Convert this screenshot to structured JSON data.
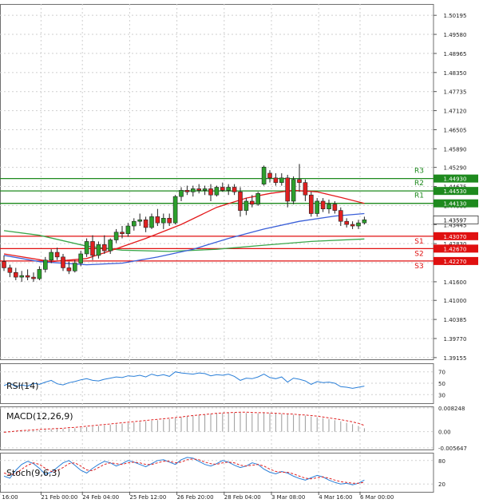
{
  "chart_data": {
    "type": "candlestick",
    "main": {
      "ylim": [
        1.391,
        1.5056
      ],
      "price_ticks": [
        "1.50195",
        "1.49580",
        "1.48965",
        "1.48350",
        "1.47735",
        "1.47120",
        "1.46505",
        "1.45890",
        "1.45290",
        "1.44675",
        "1.44060",
        "1.43445",
        "1.42830",
        "1.42215",
        "1.41600",
        "1.41000",
        "1.40385",
        "1.39770",
        "1.39155"
      ],
      "current_price": "1.43597",
      "levels": [
        {
          "name": "R3",
          "value": 1.4493,
          "label": "1.44930",
          "color": "#1e8a1e"
        },
        {
          "name": "R2",
          "value": 1.4453,
          "label": "1.44530",
          "color": "#1e8a1e"
        },
        {
          "name": "R1",
          "value": 1.4413,
          "label": "1.44130",
          "color": "#1e8a1e"
        },
        {
          "name": "S1",
          "value": 1.4307,
          "label": "1.43070",
          "color": "#e01010"
        },
        {
          "name": "S2",
          "value": 1.4267,
          "label": "1.42670",
          "color": "#e01010"
        },
        {
          "name": "S3",
          "value": 1.4227,
          "label": "1.42270",
          "color": "#e01010"
        }
      ],
      "candles": [
        [
          1.4225,
          1.4245,
          1.4195,
          1.4205
        ],
        [
          1.4205,
          1.4215,
          1.4175,
          1.419
        ],
        [
          1.419,
          1.4205,
          1.4165,
          1.4175
        ],
        [
          1.4175,
          1.4195,
          1.416,
          1.418
        ],
        [
          1.418,
          1.42,
          1.4165,
          1.4175
        ],
        [
          1.4175,
          1.419,
          1.416,
          1.417
        ],
        [
          1.417,
          1.421,
          1.4165,
          1.42
        ],
        [
          1.42,
          1.424,
          1.419,
          1.423
        ],
        [
          1.423,
          1.4265,
          1.422,
          1.4255
        ],
        [
          1.4255,
          1.427,
          1.423,
          1.424
        ],
        [
          1.424,
          1.425,
          1.4195,
          1.4205
        ],
        [
          1.4205,
          1.4225,
          1.4185,
          1.4195
        ],
        [
          1.4195,
          1.423,
          1.419,
          1.422
        ],
        [
          1.422,
          1.426,
          1.421,
          1.425
        ],
        [
          1.425,
          1.43,
          1.424,
          1.429
        ],
        [
          1.429,
          1.431,
          1.423,
          1.4245
        ],
        [
          1.4245,
          1.429,
          1.4235,
          1.428
        ],
        [
          1.428,
          1.431,
          1.425,
          1.426
        ],
        [
          1.426,
          1.43,
          1.425,
          1.4295
        ],
        [
          1.4295,
          1.433,
          1.4285,
          1.432
        ],
        [
          1.432,
          1.434,
          1.43,
          1.4315
        ],
        [
          1.4315,
          1.435,
          1.4305,
          1.434
        ],
        [
          1.434,
          1.4365,
          1.4325,
          1.4355
        ],
        [
          1.4355,
          1.438,
          1.434,
          1.436
        ],
        [
          1.436,
          1.437,
          1.432,
          1.4335
        ],
        [
          1.4335,
          1.438,
          1.433,
          1.437
        ],
        [
          1.437,
          1.4395,
          1.434,
          1.435
        ],
        [
          1.435,
          1.438,
          1.433,
          1.4365
        ],
        [
          1.4365,
          1.438,
          1.434,
          1.435
        ],
        [
          1.435,
          1.444,
          1.4345,
          1.4435
        ],
        [
          1.4435,
          1.4465,
          1.442,
          1.4455
        ],
        [
          1.4455,
          1.447,
          1.444,
          1.445
        ],
        [
          1.445,
          1.447,
          1.4435,
          1.446
        ],
        [
          1.446,
          1.4475,
          1.4445,
          1.4455
        ],
        [
          1.4455,
          1.447,
          1.444,
          1.446
        ],
        [
          1.446,
          1.4475,
          1.442,
          1.444
        ],
        [
          1.444,
          1.447,
          1.4435,
          1.4465
        ],
        [
          1.4465,
          1.448,
          1.445,
          1.4455
        ],
        [
          1.4455,
          1.4475,
          1.444,
          1.4465
        ],
        [
          1.4465,
          1.4475,
          1.444,
          1.445
        ],
        [
          1.445,
          1.4465,
          1.437,
          1.439
        ],
        [
          1.439,
          1.443,
          1.4375,
          1.442
        ],
        [
          1.442,
          1.444,
          1.44,
          1.441
        ],
        [
          1.441,
          1.445,
          1.4405,
          1.4445
        ],
        [
          1.4475,
          1.4535,
          1.447,
          1.453
        ],
        [
          1.451,
          1.452,
          1.448,
          1.4495
        ],
        [
          1.4495,
          1.451,
          1.447,
          1.448
        ],
        [
          1.448,
          1.451,
          1.447,
          1.4495
        ],
        [
          1.4495,
          1.4505,
          1.44,
          1.442
        ],
        [
          1.442,
          1.45,
          1.441,
          1.449
        ],
        [
          1.449,
          1.454,
          1.445,
          1.448
        ],
        [
          1.448,
          1.449,
          1.442,
          1.444
        ],
        [
          1.444,
          1.445,
          1.437,
          1.438
        ],
        [
          1.438,
          1.443,
          1.437,
          1.442
        ],
        [
          1.442,
          1.443,
          1.4385,
          1.4395
        ],
        [
          1.4395,
          1.4425,
          1.438,
          1.441
        ],
        [
          1.441,
          1.442,
          1.438,
          1.439
        ],
        [
          1.439,
          1.44,
          1.434,
          1.4355
        ],
        [
          1.4355,
          1.4365,
          1.4335,
          1.4345
        ],
        [
          1.4345,
          1.4355,
          1.433,
          1.434
        ],
        [
          1.434,
          1.436,
          1.433,
          1.435
        ],
        [
          1.435,
          1.437,
          1.4345,
          1.436
        ]
      ],
      "ma_red": [
        [
          0,
          1.425
        ],
        [
          8,
          1.4225
        ],
        [
          14,
          1.4235
        ],
        [
          18,
          1.426
        ],
        [
          24,
          1.43
        ],
        [
          30,
          1.4345
        ],
        [
          36,
          1.44
        ],
        [
          41,
          1.443
        ],
        [
          45,
          1.4445
        ],
        [
          49,
          1.4455
        ],
        [
          53,
          1.445
        ],
        [
          57,
          1.4432
        ],
        [
          61,
          1.4413
        ]
      ],
      "ma_blue": [
        [
          0,
          1.4245
        ],
        [
          6,
          1.4225
        ],
        [
          14,
          1.4215
        ],
        [
          20,
          1.422
        ],
        [
          26,
          1.424
        ],
        [
          32,
          1.4265
        ],
        [
          38,
          1.43
        ],
        [
          44,
          1.433
        ],
        [
          50,
          1.4355
        ],
        [
          56,
          1.4372
        ],
        [
          61,
          1.438
        ]
      ],
      "ma_green": [
        [
          0,
          1.4325
        ],
        [
          6,
          1.431
        ],
        [
          14,
          1.4275
        ],
        [
          20,
          1.4262
        ],
        [
          28,
          1.4258
        ],
        [
          36,
          1.4265
        ],
        [
          44,
          1.4278
        ],
        [
          52,
          1.429
        ],
        [
          61,
          1.4298
        ]
      ]
    },
    "rsi": {
      "label": "RSI(14)",
      "ticks": [
        "70",
        "50",
        "30"
      ],
      "ylim": [
        15,
        85
      ],
      "values": [
        46,
        50,
        44,
        47,
        45,
        50,
        48,
        52,
        55,
        49,
        47,
        51,
        53,
        56,
        58,
        55,
        54,
        57,
        59,
        61,
        60,
        63,
        62,
        64,
        61,
        66,
        63,
        65,
        62,
        70,
        68,
        67,
        66,
        68,
        67,
        63,
        65,
        64,
        66,
        62,
        55,
        59,
        58,
        61,
        66,
        60,
        58,
        61,
        52,
        59,
        57,
        54,
        48,
        53,
        51,
        52,
        50,
        44,
        43,
        41,
        43,
        45
      ]
    },
    "macd": {
      "label": "MACD(12,26,9)",
      "ticks": [
        "0.008248",
        "0.00",
        "-0.005647"
      ],
      "ylim": [
        -0.0062,
        0.0088
      ],
      "bars": [
        -0.0003,
        -0.0002,
        0,
        0.0002,
        0.0003,
        0.0004,
        0.0005,
        0.0006,
        0.0008,
        0.0009,
        0.001,
        0.0011,
        0.0012,
        0.0014,
        0.0016,
        0.0018,
        0.002,
        0.0022,
        0.0024,
        0.0026,
        0.0028,
        0.003,
        0.0032,
        0.0034,
        0.0036,
        0.0038,
        0.004,
        0.0042,
        0.0044,
        0.0047,
        0.005,
        0.0053,
        0.0056,
        0.0058,
        0.006,
        0.0062,
        0.0063,
        0.0064,
        0.0065,
        0.0066,
        0.0066,
        0.0065,
        0.0064,
        0.0064,
        0.0065,
        0.0064,
        0.0063,
        0.0062,
        0.006,
        0.0059,
        0.0058,
        0.0056,
        0.0053,
        0.005,
        0.0047,
        0.0044,
        0.004,
        0.0036,
        0.0031,
        0.0026,
        0.002,
        0.0012
      ],
      "signal": [
        -0.0002,
        0,
        0.0002,
        0.0004,
        0.0005,
        0.0006,
        0.0008,
        0.0009,
        0.001,
        0.0011,
        0.0012,
        0.0014,
        0.0015,
        0.0017,
        0.0019,
        0.0021,
        0.0023,
        0.0025,
        0.0027,
        0.0029,
        0.0031,
        0.0033,
        0.0035,
        0.0037,
        0.0039,
        0.0041,
        0.0043,
        0.0045,
        0.0047,
        0.0049,
        0.0051,
        0.0054,
        0.0056,
        0.0058,
        0.006,
        0.0062,
        0.0064,
        0.0065,
        0.0066,
        0.0067,
        0.0068,
        0.0068,
        0.0067,
        0.0066,
        0.0066,
        0.0065,
        0.0064,
        0.0063,
        0.0062,
        0.0061,
        0.0059,
        0.0058,
        0.0056,
        0.0054,
        0.0051,
        0.0048,
        0.0045,
        0.0042,
        0.0038,
        0.0034,
        0.0029,
        0.0022
      ]
    },
    "stoch": {
      "label": "Stoch(9,6,3)",
      "ticks": [
        "80",
        "20"
      ],
      "ylim": [
        0,
        100
      ],
      "main": [
        40,
        35,
        55,
        70,
        78,
        72,
        60,
        45,
        50,
        62,
        74,
        80,
        68,
        55,
        48,
        60,
        70,
        78,
        74,
        66,
        72,
        80,
        76,
        70,
        64,
        72,
        80,
        82,
        76,
        70,
        82,
        88,
        86,
        78,
        70,
        66,
        72,
        80,
        76,
        68,
        62,
        66,
        74,
        70,
        58,
        50,
        46,
        52,
        48,
        40,
        34,
        30,
        36,
        42,
        38,
        30,
        24,
        20,
        22,
        18,
        22,
        30
      ],
      "signal": [
        48,
        44,
        46,
        58,
        68,
        74,
        70,
        60,
        52,
        54,
        62,
        72,
        74,
        66,
        56,
        54,
        62,
        70,
        74,
        72,
        70,
        74,
        76,
        74,
        70,
        70,
        74,
        78,
        78,
        74,
        76,
        82,
        84,
        82,
        76,
        72,
        70,
        74,
        76,
        74,
        68,
        66,
        68,
        70,
        66,
        58,
        52,
        50,
        50,
        46,
        40,
        35,
        33,
        36,
        38,
        35,
        30,
        26,
        24,
        22,
        22,
        24
      ]
    },
    "xaxis": {
      "labels": [
        {
          "text": "20 Feb 16:00",
          "index": -1
        },
        {
          "text": "21 Feb 00:00",
          "index": 6
        },
        {
          "text": "24 Feb 04:00",
          "index": 13
        },
        {
          "text": "25 Feb 12:00",
          "index": 21
        },
        {
          "text": "26 Feb 20:00",
          "index": 29
        },
        {
          "text": "28 Feb 04:00",
          "index": 37
        },
        {
          "text": "3 Mar 08:00",
          "index": 45
        },
        {
          "text": "4 Mar 16:00",
          "index": 53
        },
        {
          "text": "6 Mar 00:00",
          "index": 60
        }
      ]
    },
    "colors": {
      "bull": "#2ca02c",
      "bear": "#e02020",
      "grid": "#cfcfcf",
      "ma_red": "#e31a1c",
      "ma_blue": "#3a5fd8",
      "ma_green": "#3aa64a",
      "rsi": "#2a7fd8",
      "macd_bar": "#9a9a9a",
      "macd_signal": "#e02020",
      "stoch_main": "#2a7fd8",
      "stoch_signal": "#e02020"
    }
  }
}
